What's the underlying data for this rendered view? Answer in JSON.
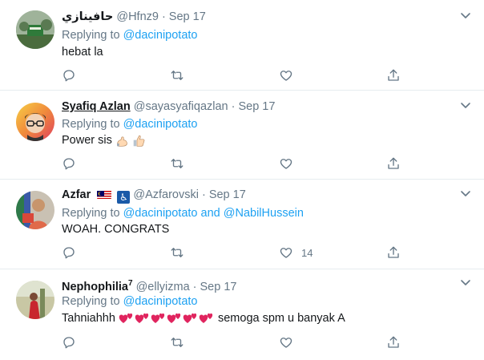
{
  "tweets": [
    {
      "name": "حافينازي",
      "handle": "@Hfnz9",
      "dot": "·",
      "date": "Sep 17",
      "replying_prefix": "Replying to",
      "replying_to": [
        "@dacinipotato"
      ],
      "text": "hebat la",
      "like_count": ""
    },
    {
      "name": "Syafiq Azlan",
      "handle": "@sayasyafiqazlan",
      "dot": "·",
      "date": "Sep 17",
      "replying_prefix": "Replying to",
      "replying_to": [
        "@dacinipotato"
      ],
      "text": "Power sis",
      "text_emojis": [
        "flexed-biceps",
        "thumbs-up"
      ],
      "like_count": ""
    },
    {
      "name": "Azfar",
      "name_badges": [
        "malaysia-flag",
        "wheelchair-symbol"
      ],
      "handle": "@Azfarovski",
      "dot": "·",
      "date": "Sep 17",
      "replying_prefix": "Replying to",
      "replying_to": [
        "@dacinipotato",
        "@NabilHussein"
      ],
      "replying_joiner": "and",
      "text": "WOAH. CONGRATS",
      "like_count": "14"
    },
    {
      "name": "Nephophilia",
      "name_sup": "7",
      "handle": "@ellyizma",
      "dot": "·",
      "date": "Sep 17",
      "replying_prefix": "Replying to",
      "replying_to": [
        "@dacinipotato"
      ],
      "text_before": "Tahniahhh",
      "text_emojis": [
        "two-hearts",
        "two-hearts",
        "two-hearts",
        "two-hearts",
        "two-hearts",
        "two-hearts"
      ],
      "text_after": "semoga spm u banyak A",
      "like_count": ""
    }
  ],
  "colors": {
    "link": "#1da1f2",
    "muted": "#657786",
    "text": "#14171a",
    "divider": "#e6ecf0",
    "heart": "#e0245e"
  },
  "icons": {
    "reply": "reply-icon",
    "retweet": "retweet-icon",
    "like": "like-icon",
    "share": "share-icon",
    "more": "chevron-down-icon"
  }
}
